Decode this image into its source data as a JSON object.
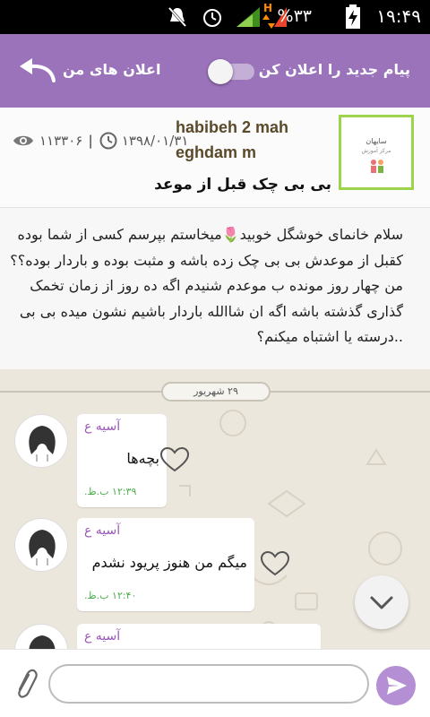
{
  "status_bar": {
    "time": "۱۹:۴۹",
    "battery": "%۳۳",
    "network": "H"
  },
  "header": {
    "notify_label": "پیام جدید را اعلان کن",
    "my_ads_label": "اعلان های من",
    "accent_color": "#9b73bb",
    "toggle_on": false
  },
  "post": {
    "author": "habibeh 2 mah eghdam m",
    "date": "۱۳۹۸/۰۱/۳۱",
    "views": "۱۱۳۳۰۶",
    "title": "بی بی چک قبل از موعد",
    "thumbnail": {
      "title": "سایهان",
      "subtitle": "مرکز آموزش"
    }
  },
  "body_text": "سلام خانمای خوشگل خوبید🌷میخاستم بپرسم کسی از شما بوده کقبل از موعدش بی بی چک زده باشه و مثبت بوده و باردار بوده؟؟من چهار روز مونده ب موعدم شنیدم اگه ده روز از زمان تخمک گذاری گذشته باشه اگه ان شاالله باردار باشیم نشون میده بی بی ..درسته یا اشتباه میکنم؟",
  "chat": {
    "date_divider": "۲۹ شهریور",
    "messages": [
      {
        "sender": "آسیه ع",
        "text": "بچه‌ها",
        "time": "۱۲:۳۹ ب.ظ."
      },
      {
        "sender": "آسیه ع",
        "text": "میگم من هنوز پریود نشدم",
        "time": "۱۲:۴۰ ب.ظ."
      },
      {
        "sender": "آسیه ع",
        "text": "",
        "time": ""
      }
    ]
  },
  "input": {
    "placeholder": ""
  },
  "icons": {
    "back": "back-arrow-icon",
    "views": "eye-icon",
    "date": "clock-icon",
    "like": "heart-icon",
    "scroll": "chevron-down-icon",
    "attach": "paperclip-icon",
    "send": "send-icon"
  }
}
